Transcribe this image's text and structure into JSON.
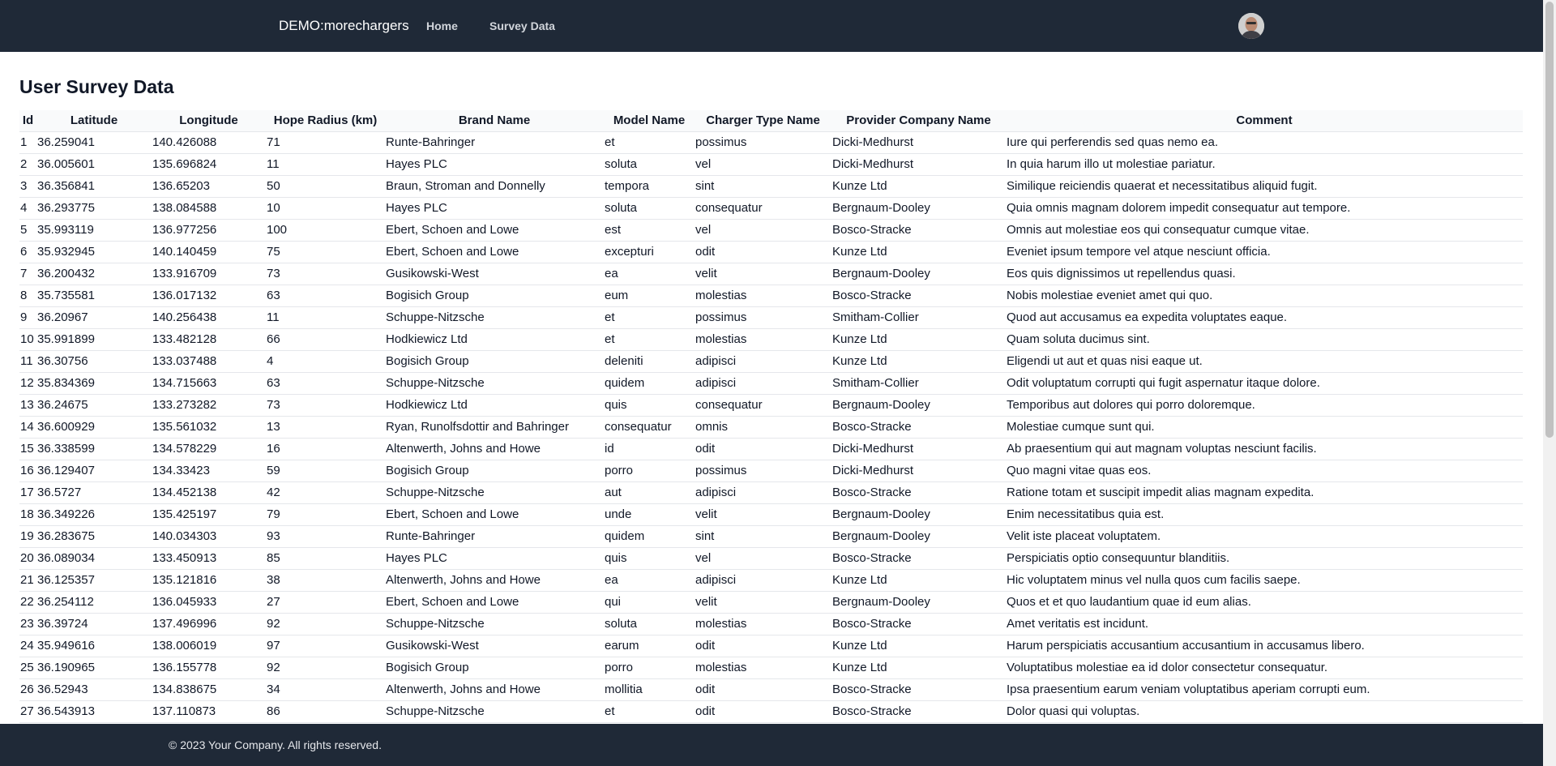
{
  "nav": {
    "brand": "DEMO:morechargers",
    "links": [
      "Home",
      "Survey Data"
    ]
  },
  "page": {
    "title": "User Survey Data"
  },
  "table": {
    "columns": [
      "Id",
      "Latitude",
      "Longitude",
      "Hope Radius (km)",
      "Brand Name",
      "Model Name",
      "Charger Type Name",
      "Provider Company Name",
      "Comment"
    ],
    "rows": [
      [
        "1",
        "36.259041",
        "140.426088",
        "71",
        "Runte-Bahringer",
        "et",
        "possimus",
        "Dicki-Medhurst",
        "Iure qui perferendis sed quas nemo ea."
      ],
      [
        "2",
        "36.005601",
        "135.696824",
        "11",
        "Hayes PLC",
        "soluta",
        "vel",
        "Dicki-Medhurst",
        "In quia harum illo ut molestiae pariatur."
      ],
      [
        "3",
        "36.356841",
        "136.65203",
        "50",
        "Braun, Stroman and Donnelly",
        "tempora",
        "sint",
        "Kunze Ltd",
        "Similique reiciendis quaerat et necessitatibus aliquid fugit."
      ],
      [
        "4",
        "36.293775",
        "138.084588",
        "10",
        "Hayes PLC",
        "soluta",
        "consequatur",
        "Bergnaum-Dooley",
        "Quia omnis magnam dolorem impedit consequatur aut tempore."
      ],
      [
        "5",
        "35.993119",
        "136.977256",
        "100",
        "Ebert, Schoen and Lowe",
        "est",
        "vel",
        "Bosco-Stracke",
        "Omnis aut molestiae eos qui consequatur cumque vitae."
      ],
      [
        "6",
        "35.932945",
        "140.140459",
        "75",
        "Ebert, Schoen and Lowe",
        "excepturi",
        "odit",
        "Kunze Ltd",
        "Eveniet ipsum tempore vel atque nesciunt officia."
      ],
      [
        "7",
        "36.200432",
        "133.916709",
        "73",
        "Gusikowski-West",
        "ea",
        "velit",
        "Bergnaum-Dooley",
        "Eos quis dignissimos ut repellendus quasi."
      ],
      [
        "8",
        "35.735581",
        "136.017132",
        "63",
        "Bogisich Group",
        "eum",
        "molestias",
        "Bosco-Stracke",
        "Nobis molestiae eveniet amet qui quo."
      ],
      [
        "9",
        "36.20967",
        "140.256438",
        "11",
        "Schuppe-Nitzsche",
        "et",
        "possimus",
        "Smitham-Collier",
        "Quod aut accusamus ea expedita voluptates eaque."
      ],
      [
        "10",
        "35.991899",
        "133.482128",
        "66",
        "Hodkiewicz Ltd",
        "et",
        "molestias",
        "Kunze Ltd",
        "Quam soluta ducimus sint."
      ],
      [
        "11",
        "36.30756",
        "133.037488",
        "4",
        "Bogisich Group",
        "deleniti",
        "adipisci",
        "Kunze Ltd",
        "Eligendi ut aut et quas nisi eaque ut."
      ],
      [
        "12",
        "35.834369",
        "134.715663",
        "63",
        "Schuppe-Nitzsche",
        "quidem",
        "adipisci",
        "Smitham-Collier",
        "Odit voluptatum corrupti qui fugit aspernatur itaque dolore."
      ],
      [
        "13",
        "36.24675",
        "133.273282",
        "73",
        "Hodkiewicz Ltd",
        "quis",
        "consequatur",
        "Bergnaum-Dooley",
        "Temporibus aut dolores qui porro doloremque."
      ],
      [
        "14",
        "36.600929",
        "135.561032",
        "13",
        "Ryan, Runolfsdottir and Bahringer",
        "consequatur",
        "omnis",
        "Bosco-Stracke",
        "Molestiae cumque sunt qui."
      ],
      [
        "15",
        "36.338599",
        "134.578229",
        "16",
        "Altenwerth, Johns and Howe",
        "id",
        "odit",
        "Dicki-Medhurst",
        "Ab praesentium qui aut magnam voluptas nesciunt facilis."
      ],
      [
        "16",
        "36.129407",
        "134.33423",
        "59",
        "Bogisich Group",
        "porro",
        "possimus",
        "Dicki-Medhurst",
        "Quo magni vitae quas eos."
      ],
      [
        "17",
        "36.5727",
        "134.452138",
        "42",
        "Schuppe-Nitzsche",
        "aut",
        "adipisci",
        "Bosco-Stracke",
        "Ratione totam et suscipit impedit alias magnam expedita."
      ],
      [
        "18",
        "36.349226",
        "135.425197",
        "79",
        "Ebert, Schoen and Lowe",
        "unde",
        "velit",
        "Bergnaum-Dooley",
        "Enim necessitatibus quia est."
      ],
      [
        "19",
        "36.283675",
        "140.034303",
        "93",
        "Runte-Bahringer",
        "quidem",
        "sint",
        "Bergnaum-Dooley",
        "Velit iste placeat voluptatem."
      ],
      [
        "20",
        "36.089034",
        "133.450913",
        "85",
        "Hayes PLC",
        "quis",
        "vel",
        "Bosco-Stracke",
        "Perspiciatis optio consequuntur blanditiis."
      ],
      [
        "21",
        "36.125357",
        "135.121816",
        "38",
        "Altenwerth, Johns and Howe",
        "ea",
        "adipisci",
        "Kunze Ltd",
        "Hic voluptatem minus vel nulla quos cum facilis saepe."
      ],
      [
        "22",
        "36.254112",
        "136.045933",
        "27",
        "Ebert, Schoen and Lowe",
        "qui",
        "velit",
        "Bergnaum-Dooley",
        "Quos et et quo laudantium quae id eum alias."
      ],
      [
        "23",
        "36.39724",
        "137.496996",
        "92",
        "Schuppe-Nitzsche",
        "soluta",
        "molestias",
        "Bosco-Stracke",
        "Amet veritatis est incidunt."
      ],
      [
        "24",
        "35.949616",
        "138.006019",
        "97",
        "Gusikowski-West",
        "earum",
        "odit",
        "Kunze Ltd",
        "Harum perspiciatis accusantium accusantium in accusamus libero."
      ],
      [
        "25",
        "36.190965",
        "136.155778",
        "92",
        "Bogisich Group",
        "porro",
        "molestias",
        "Kunze Ltd",
        "Voluptatibus molestiae ea id dolor consectetur consequatur."
      ],
      [
        "26",
        "36.52943",
        "134.838675",
        "34",
        "Altenwerth, Johns and Howe",
        "mollitia",
        "odit",
        "Bosco-Stracke",
        "Ipsa praesentium earum veniam voluptatibus aperiam corrupti eum."
      ],
      [
        "27",
        "36.543913",
        "137.110873",
        "86",
        "Schuppe-Nitzsche",
        "et",
        "odit",
        "Bosco-Stracke",
        "Dolor quasi qui voluptas."
      ]
    ]
  },
  "footer": {
    "copyright": "© 2023 Your Company. All rights reserved."
  },
  "colors": {
    "nav_background": "#1f2937",
    "footer_background": "#1f2937",
    "row_border": "#e5e7eb"
  },
  "icons": {
    "avatar": "user-avatar-photo"
  }
}
